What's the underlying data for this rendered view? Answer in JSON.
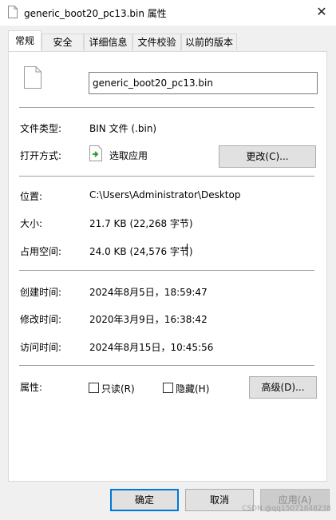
{
  "window": {
    "title": "generic_boot20_pc13.bin 属性",
    "close_glyph": "✕",
    "icon": "document-icon"
  },
  "tabs": [
    {
      "label": "常规",
      "active": true
    },
    {
      "label": "安全",
      "active": false
    },
    {
      "label": "详细信息",
      "active": false
    },
    {
      "label": "文件校验",
      "active": false
    },
    {
      "label": "以前的版本",
      "active": false
    }
  ],
  "general": {
    "file_name": "generic_boot20_pc13.bin",
    "file_type_label": "文件类型:",
    "file_type_value": "BIN 文件 (.bin)",
    "opens_with_label": "打开方式:",
    "opens_with_value": "选取应用",
    "change_button": "更改(C)...",
    "location_label": "位置:",
    "location_value": "C:\\Users\\Administrator\\Desktop",
    "size_label": "大小:",
    "size_value": "21.7 KB (22,268 字节)",
    "size_on_disk_label": "占用空间:",
    "size_on_disk_value": "24.0 KB (24,576 字节)",
    "created_label": "创建时间:",
    "created_value": "2024年8月5日，18:59:47",
    "modified_label": "修改时间:",
    "modified_value": "2020年3月9日，16:38:42",
    "accessed_label": "访问时间:",
    "accessed_value": "2024年8月15日，10:45:56",
    "attributes_label": "属性:",
    "readonly_label": "只读(R)",
    "readonly_checked": false,
    "hidden_label": "隐藏(H)",
    "hidden_checked": false,
    "advanced_button": "高级(D)..."
  },
  "footer": {
    "ok_label": "确定",
    "cancel_label": "取消",
    "apply_label": "应用(A)",
    "watermark": "CSDN @qq15071848238"
  }
}
